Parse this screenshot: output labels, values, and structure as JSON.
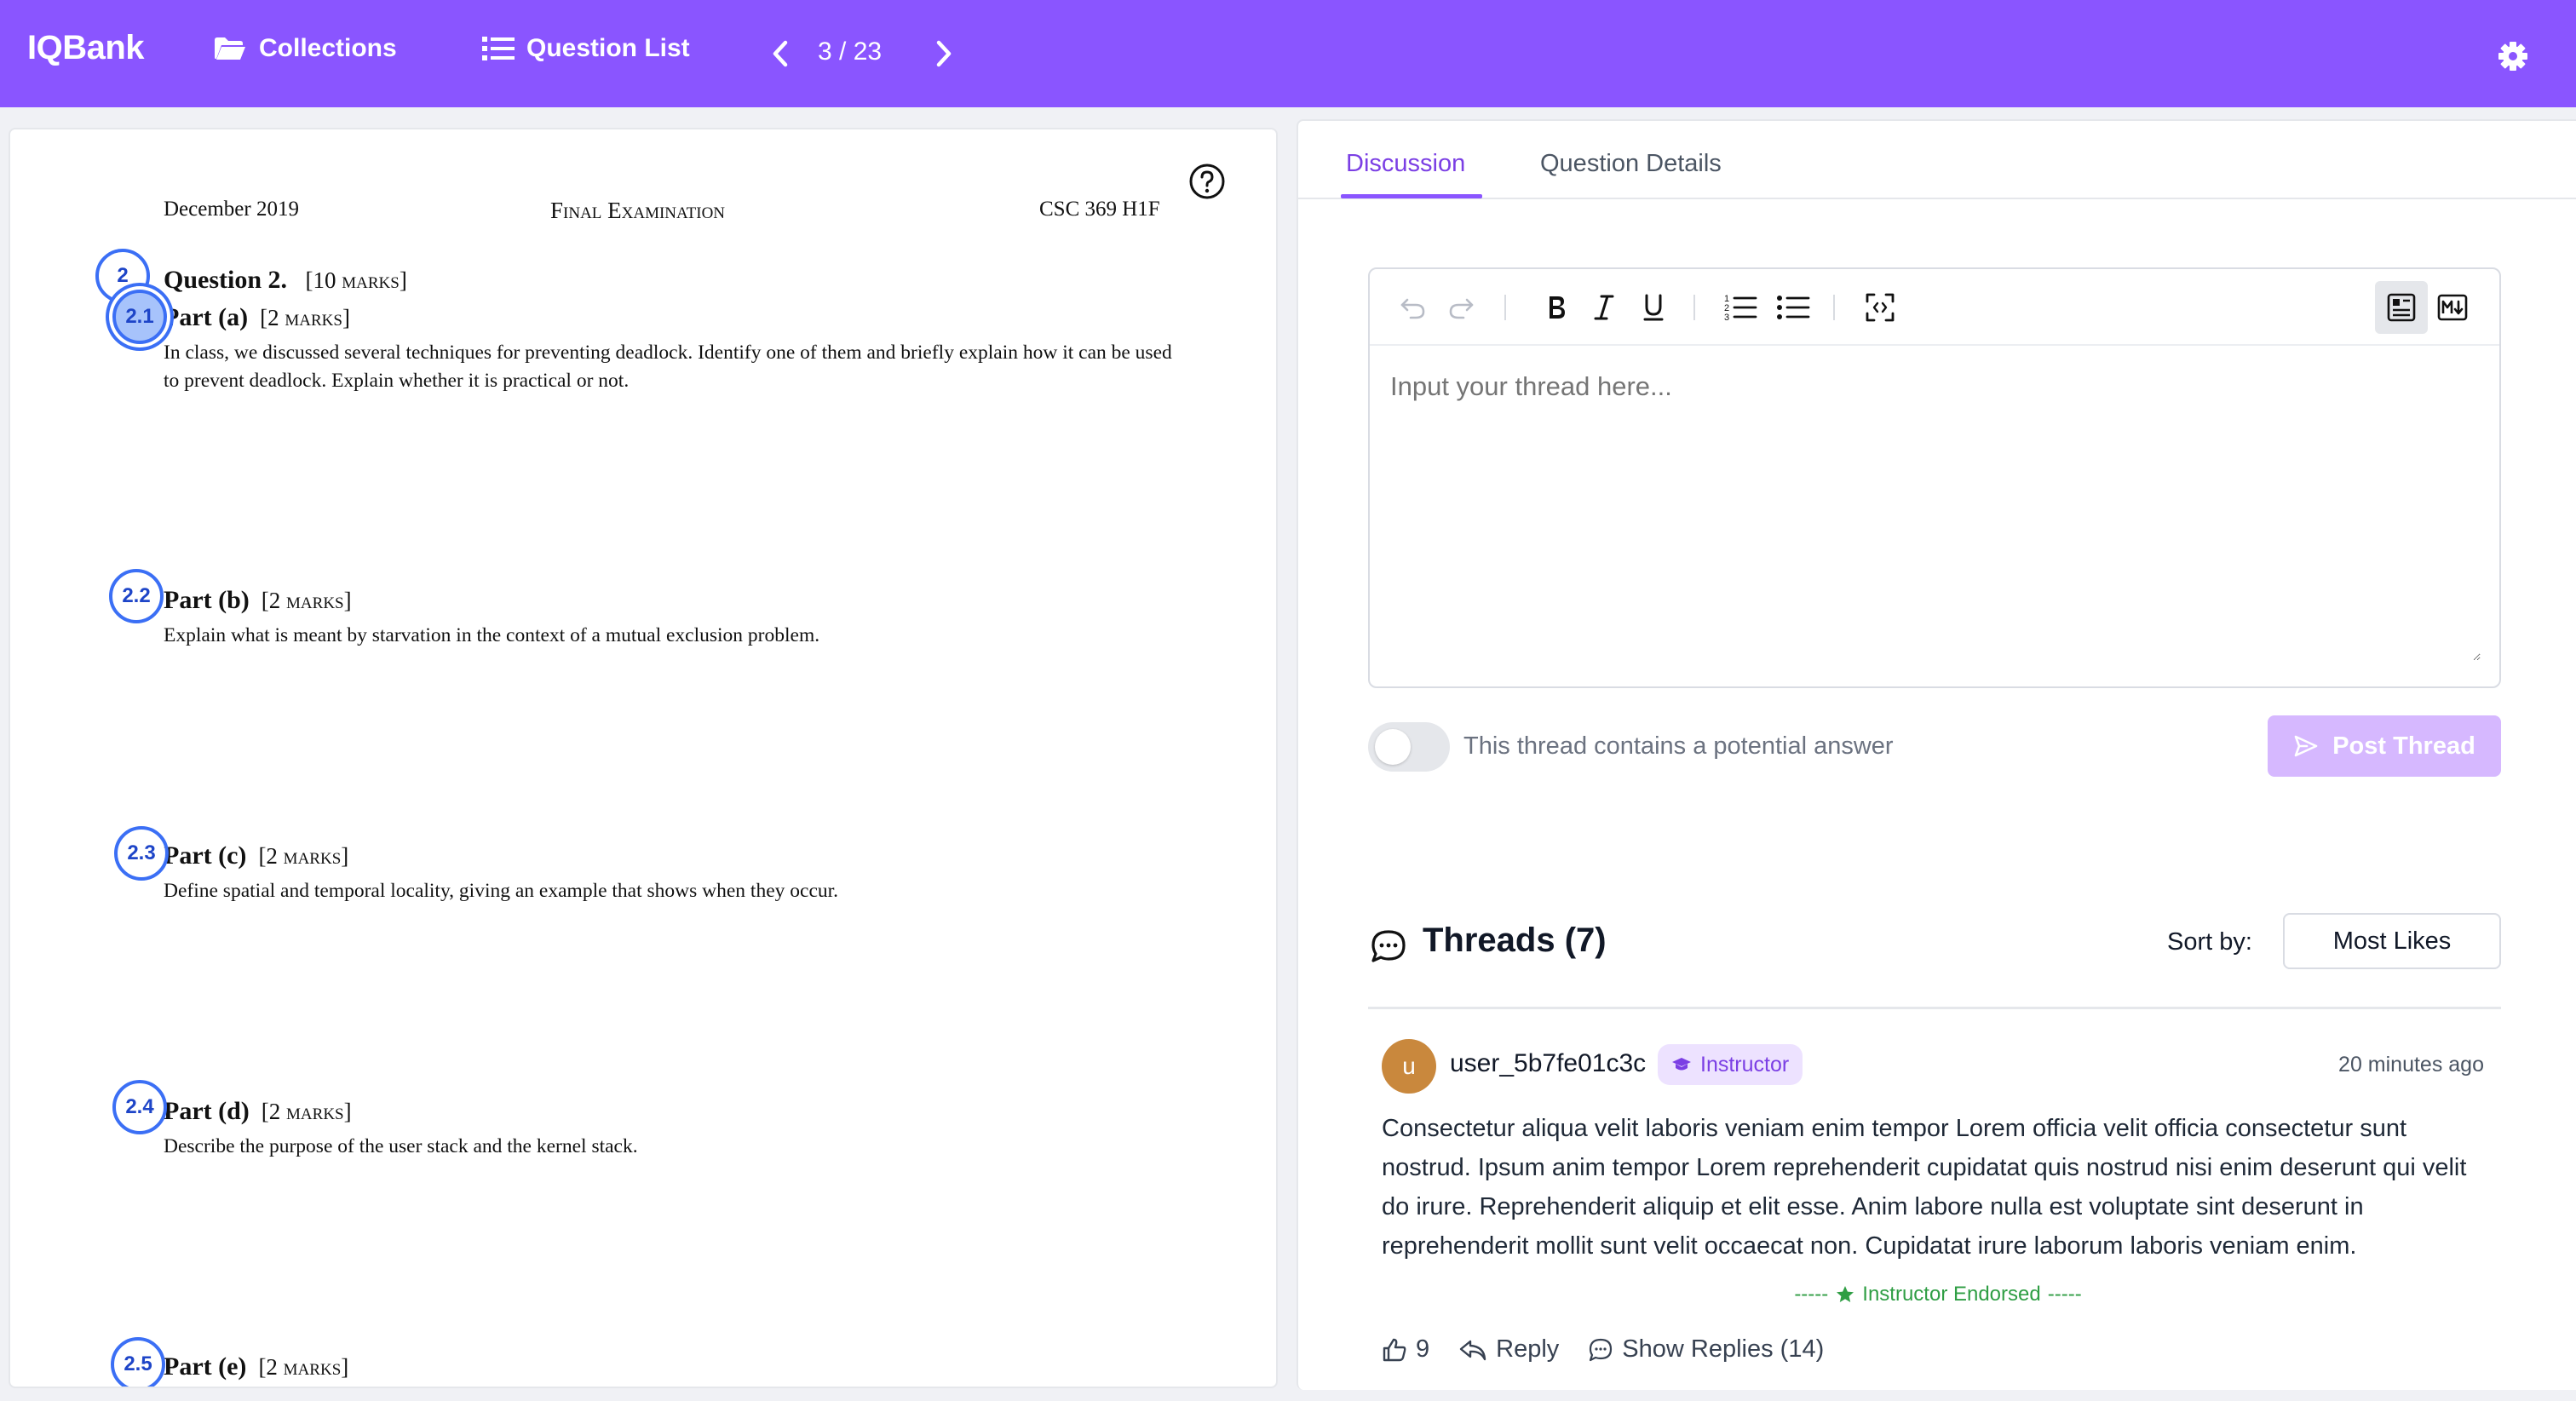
{
  "topbar": {
    "logo": "IQBank",
    "collections_label": "Collections",
    "question_list_label": "Question List",
    "pager": "3 / 23"
  },
  "pdf": {
    "header_left": "December 2019",
    "header_center": "Final Examination",
    "header_right": "CSC 369 H1F",
    "question": {
      "title": "Question 2.",
      "marks": "[10 marks]",
      "badge": "2"
    },
    "parts": [
      {
        "badge": "2.1",
        "title": "Part (a)",
        "marks": "[2 marks]",
        "text": "In class, we discussed several techniques for preventing deadlock. Identify one of them and briefly explain how it can be used to prevent deadlock. Explain whether it is practical or not."
      },
      {
        "badge": "2.2",
        "title": "Part (b)",
        "marks": "[2 marks]",
        "text": "Explain what is meant by starvation in the context of a mutual exclusion problem."
      },
      {
        "badge": "2.3",
        "title": "Part (c)",
        "marks": "[2 marks]",
        "text": "Define spatial and temporal locality, giving an example that shows when they occur."
      },
      {
        "badge": "2.4",
        "title": "Part (d)",
        "marks": "[2 marks]",
        "text": "Describe the purpose of the user stack and the kernel stack."
      },
      {
        "badge": "2.5",
        "title": "Part (e)",
        "marks": "[2 marks]",
        "text": ""
      }
    ]
  },
  "tabs": {
    "discussion": "Discussion",
    "details": "Question Details"
  },
  "editor": {
    "placeholder": "Input your thread here...",
    "tools": [
      "undo-icon",
      "redo-icon",
      "bold-icon",
      "italic-icon",
      "underline-icon",
      "ordered-list-icon",
      "bullet-list-icon",
      "fullscreen-icon",
      "rich-text-mode-icon",
      "markdown-mode-icon"
    ]
  },
  "answer_toggle": {
    "label": "This thread contains a potential answer",
    "on": false
  },
  "post_button": "Post Thread",
  "threads": {
    "title": "Threads (7)",
    "sort_label": "Sort by:",
    "sort_value": "Most Likes",
    "items": [
      {
        "avatar_letter": "u",
        "avatar_color": "#c9883d",
        "user": "user_5b7fe01c3c",
        "role": "Instructor",
        "time": "20 minutes ago",
        "body": "Consectetur aliqua velit laboris veniam enim tempor Lorem officia velit officia consectetur sunt nostrud. Ipsum anim tempor Lorem reprehenderit cupidatat quis nostrud nisi enim deserunt qui velit do irure. Reprehenderit aliquip et elit esse. Anim labore nulla est voluptate sint deserunt in reprehenderit mollit sunt velit occaecat non. Cupidatat irure laborum laboris veniam enim.",
        "endorsed": "----- ★ Instructor Endorsed -----",
        "endorsed_text": "Instructor Endorsed",
        "likes": "9",
        "reply_label": "Reply",
        "replies_label": "Show Replies (14)"
      }
    ]
  },
  "colors": {
    "brand": "#8a55ff",
    "accent": "#7b3fe4",
    "endorsed": "#2f9e44",
    "badge_blue": "#3b6ff5"
  }
}
